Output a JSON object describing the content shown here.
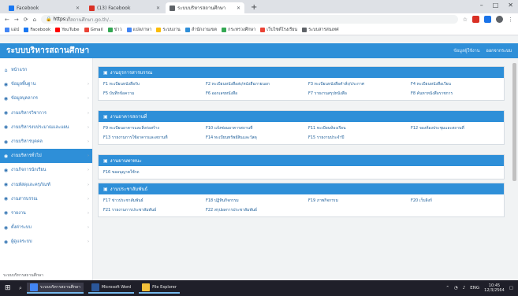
{
  "browser": {
    "tabs": [
      {
        "label": "Facebook",
        "color": "#1877f2",
        "active": false
      },
      {
        "label": "(13) Facebook",
        "color": "#d93025",
        "active": false
      },
      {
        "label": "ระบบบริหารสถานศึกษา",
        "color": "#5f6368",
        "active": true
      }
    ],
    "new_tab": "+",
    "window_controls": [
      "–",
      "□",
      "✕"
    ],
    "url_host": "https://",
    "url_path": "สถานศึกษา.go.th/...",
    "bookmarks": [
      {
        "label": "แอป",
        "color": "#4285f4"
      },
      {
        "label": "Facebook",
        "color": "#1877f2"
      },
      {
        "label": "YouTube",
        "color": "#ff0000"
      },
      {
        "label": "Gmail",
        "color": "#ea4335"
      },
      {
        "label": "ข่าว",
        "color": "#34a853"
      },
      {
        "label": "แปลภาษา",
        "color": "#4285f4"
      },
      {
        "label": "ระบบงาน",
        "color": "#fbbc05"
      },
      {
        "label": "สำนักงานเขต",
        "color": "#2e8fd8"
      },
      {
        "label": "กระทรวงศึกษา",
        "color": "#34a853"
      },
      {
        "label": "เว็บไซต์โรงเรียน",
        "color": "#ea4335"
      },
      {
        "label": "ระบบสารสนเทศ",
        "color": "#5f6368"
      }
    ]
  },
  "app": {
    "title": "ระบบบริหารสถานศึกษา",
    "header_links": [
      "ข้อมูลผู้ใช้งาน",
      "ออกจากระบบ"
    ],
    "accent": "#2e8fd8"
  },
  "sidebar": {
    "items": [
      {
        "icon": "⌂",
        "label": "หน้าแรก",
        "active": false,
        "chev": false
      },
      {
        "icon": "◉",
        "label": "ข้อมูลพื้นฐาน",
        "active": false,
        "chev": true
      },
      {
        "icon": "◉",
        "label": "ข้อมูลบุคลากร",
        "active": false,
        "chev": true
      },
      {
        "icon": "◉",
        "label": "งานบริหารวิชาการ",
        "active": false,
        "chev": true
      },
      {
        "icon": "◉",
        "label": "งานบริหารงบประมาณและแผน",
        "active": false,
        "chev": true
      },
      {
        "icon": "◉",
        "label": "งานบริหารบุคคล",
        "active": false,
        "chev": true
      },
      {
        "icon": "◉",
        "label": "งานบริหารทั่วไป",
        "active": true,
        "chev": true
      },
      {
        "icon": "◉",
        "label": "งานกิจการนักเรียน",
        "active": false,
        "chev": true
      },
      {
        "icon": "◉",
        "label": "งานพัสดุและครุภัณฑ์",
        "active": false,
        "chev": true
      },
      {
        "icon": "◉",
        "label": "งานสารบรรณ",
        "active": false,
        "chev": true
      },
      {
        "icon": "◉",
        "label": "รายงาน",
        "active": false,
        "chev": true
      },
      {
        "icon": "◉",
        "label": "ตั้งค่าระบบ",
        "active": false,
        "chev": true
      },
      {
        "icon": "◉",
        "label": "ผู้ดูแลระบบ",
        "active": false,
        "chev": true
      }
    ],
    "footer": "ระบบบริหารสถานศึกษา"
  },
  "panels": [
    {
      "title": "งานธุรการสารบรรณ",
      "links": [
        "F1 ทะเบียนหนังสือรับ",
        "F2 ทะเบียนหนังสือส่ง/หนังสือภายนอก",
        "F3 ทะเบียนหนังสือคำสั่ง/ประกาศ",
        "F4 ทะเบียนหนังสือเวียน",
        "F5 บันทึกข้อความ",
        "F6 ออกเลขหนังสือ",
        "F7 รายงานสรุปหนังสือ",
        "F8 ค้นหาหนังสือราชการ"
      ]
    },
    {
      "title": "งานอาคารสถานที่",
      "links": [
        "F9 ทะเบียนอาคารและสิ่งก่อสร้าง",
        "F10 แจ้งซ่อมอาคารสถานที่",
        "F11 ทะเบียนห้องเรียน",
        "F12 จองห้องประชุมและสถานที่",
        "F13 รายงานการใช้อาคารและสถานที่",
        "F14 ทะเบียนทรัพย์สินและวัสดุ",
        "F15 รายงานประจำปี"
      ]
    },
    {
      "title": "งานยานพาหนะ",
      "links": [
        "F16 ขออนุญาตใช้รถ"
      ]
    },
    {
      "title": "งานประชาสัมพันธ์",
      "links": [
        "F17 ข่าวประชาสัมพันธ์",
        "F18 ปฏิทินกิจกรรม",
        "F19 ภาพกิจกรรม",
        "F20 เว็บลิงก์",
        "F21 รายงานการประชาสัมพันธ์",
        "F22 สรุปผลการประชาสัมพันธ์"
      ]
    }
  ],
  "taskbar": {
    "apps": [
      {
        "label": "ระบบบริหารสถานศึกษา",
        "color": "#4285f4",
        "active": true
      },
      {
        "label": "Microsoft Word",
        "color": "#2b579a",
        "active": false
      },
      {
        "label": "File Explorer",
        "color": "#f3c13a",
        "active": false
      }
    ],
    "time": "10:45",
    "date": "12/3/2564",
    "lang": "ENG"
  }
}
